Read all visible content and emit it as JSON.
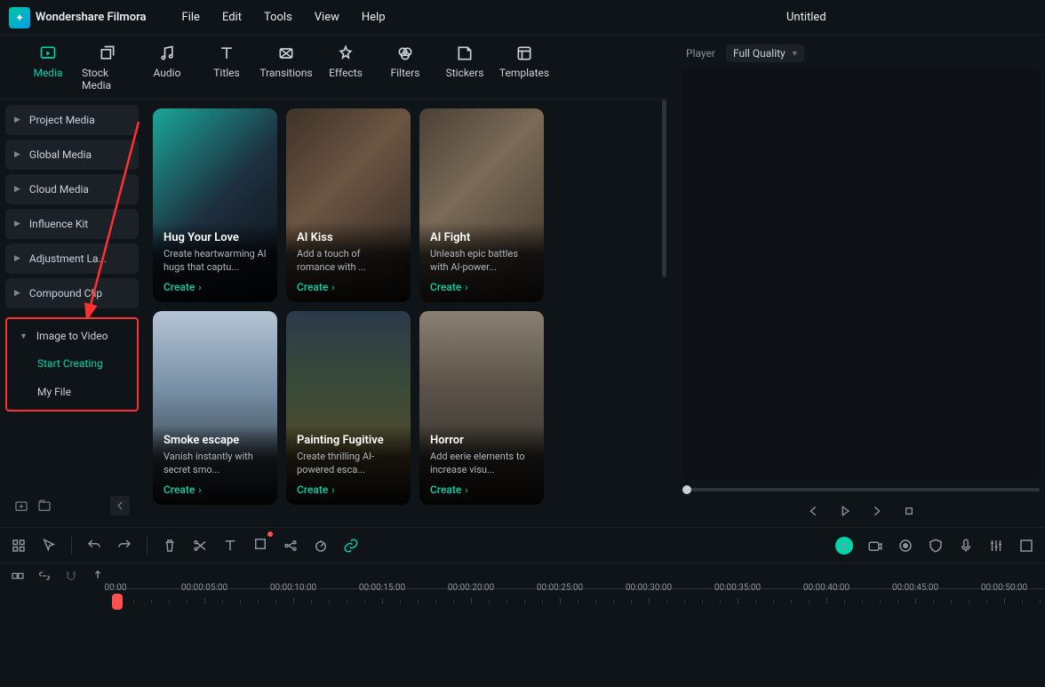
{
  "app": {
    "name": "Wondershare Filmora",
    "document": "Untitled"
  },
  "menubar": [
    "File",
    "Edit",
    "Tools",
    "View",
    "Help"
  ],
  "mediaTabs": [
    {
      "label": "Media",
      "active": true
    },
    {
      "label": "Stock Media"
    },
    {
      "label": "Audio"
    },
    {
      "label": "Titles"
    },
    {
      "label": "Transitions"
    },
    {
      "label": "Effects"
    },
    {
      "label": "Filters"
    },
    {
      "label": "Stickers"
    },
    {
      "label": "Templates"
    }
  ],
  "sidebar": {
    "items": [
      {
        "label": "Project Media"
      },
      {
        "label": "Global Media"
      },
      {
        "label": "Cloud Media"
      },
      {
        "label": "Influence Kit"
      },
      {
        "label": "Adjustment La..."
      },
      {
        "label": "Compound Clip"
      }
    ],
    "imageToVideo": {
      "label": "Image to Video",
      "children": [
        {
          "label": "Start Creating",
          "active": true
        },
        {
          "label": "My File"
        }
      ]
    }
  },
  "cards": [
    {
      "title": "Hug Your Love",
      "desc": "Create heartwarming AI hugs that captu...",
      "create": "Create"
    },
    {
      "title": "AI Kiss",
      "desc": "Add a touch of romance with ...",
      "create": "Create"
    },
    {
      "title": "AI Fight",
      "desc": "Unleash epic battles with AI-power...",
      "create": "Create"
    },
    {
      "title": "Smoke escape",
      "desc": "Vanish instantly with secret smo...",
      "create": "Create"
    },
    {
      "title": "Painting Fugitive",
      "desc": "Create thrilling AI-powered esca...",
      "create": "Create"
    },
    {
      "title": "Horror",
      "desc": "Add eerie elements to increase visu...",
      "create": "Create"
    }
  ],
  "player": {
    "label": "Player",
    "quality": "Full Quality"
  },
  "timeline": {
    "ticks": [
      "00:00",
      "00:00:05:00",
      "00:00:10:00",
      "00:00:15:00",
      "00:00:20:00",
      "00:00:25:00",
      "00:00:30:00",
      "00:00:35:00",
      "00:00:40:00",
      "00:00:45:00",
      "00:00:50:00"
    ]
  },
  "cardGradients": [
    "linear-gradient(135deg,#1aa69a 0%,#1d2f3e 50%,#0d1117 100%)",
    "linear-gradient(135deg,#3e3228 0%,#6b5542 40%,#2a2420 100%)",
    "linear-gradient(135deg,#4a4036 0%,#7a6a56 40%,#3a322a 100%)",
    "linear-gradient(180deg,#b5c4d4 0%,#7890a6 40%,#1c2128 100%)",
    "linear-gradient(180deg,#2b3a4a 0%,#3a4b38 40%,#584828 80%,#1c2128 100%)",
    "linear-gradient(180deg,#8a8074 0%,#5a5248 40%,#2a2622 100%)"
  ]
}
